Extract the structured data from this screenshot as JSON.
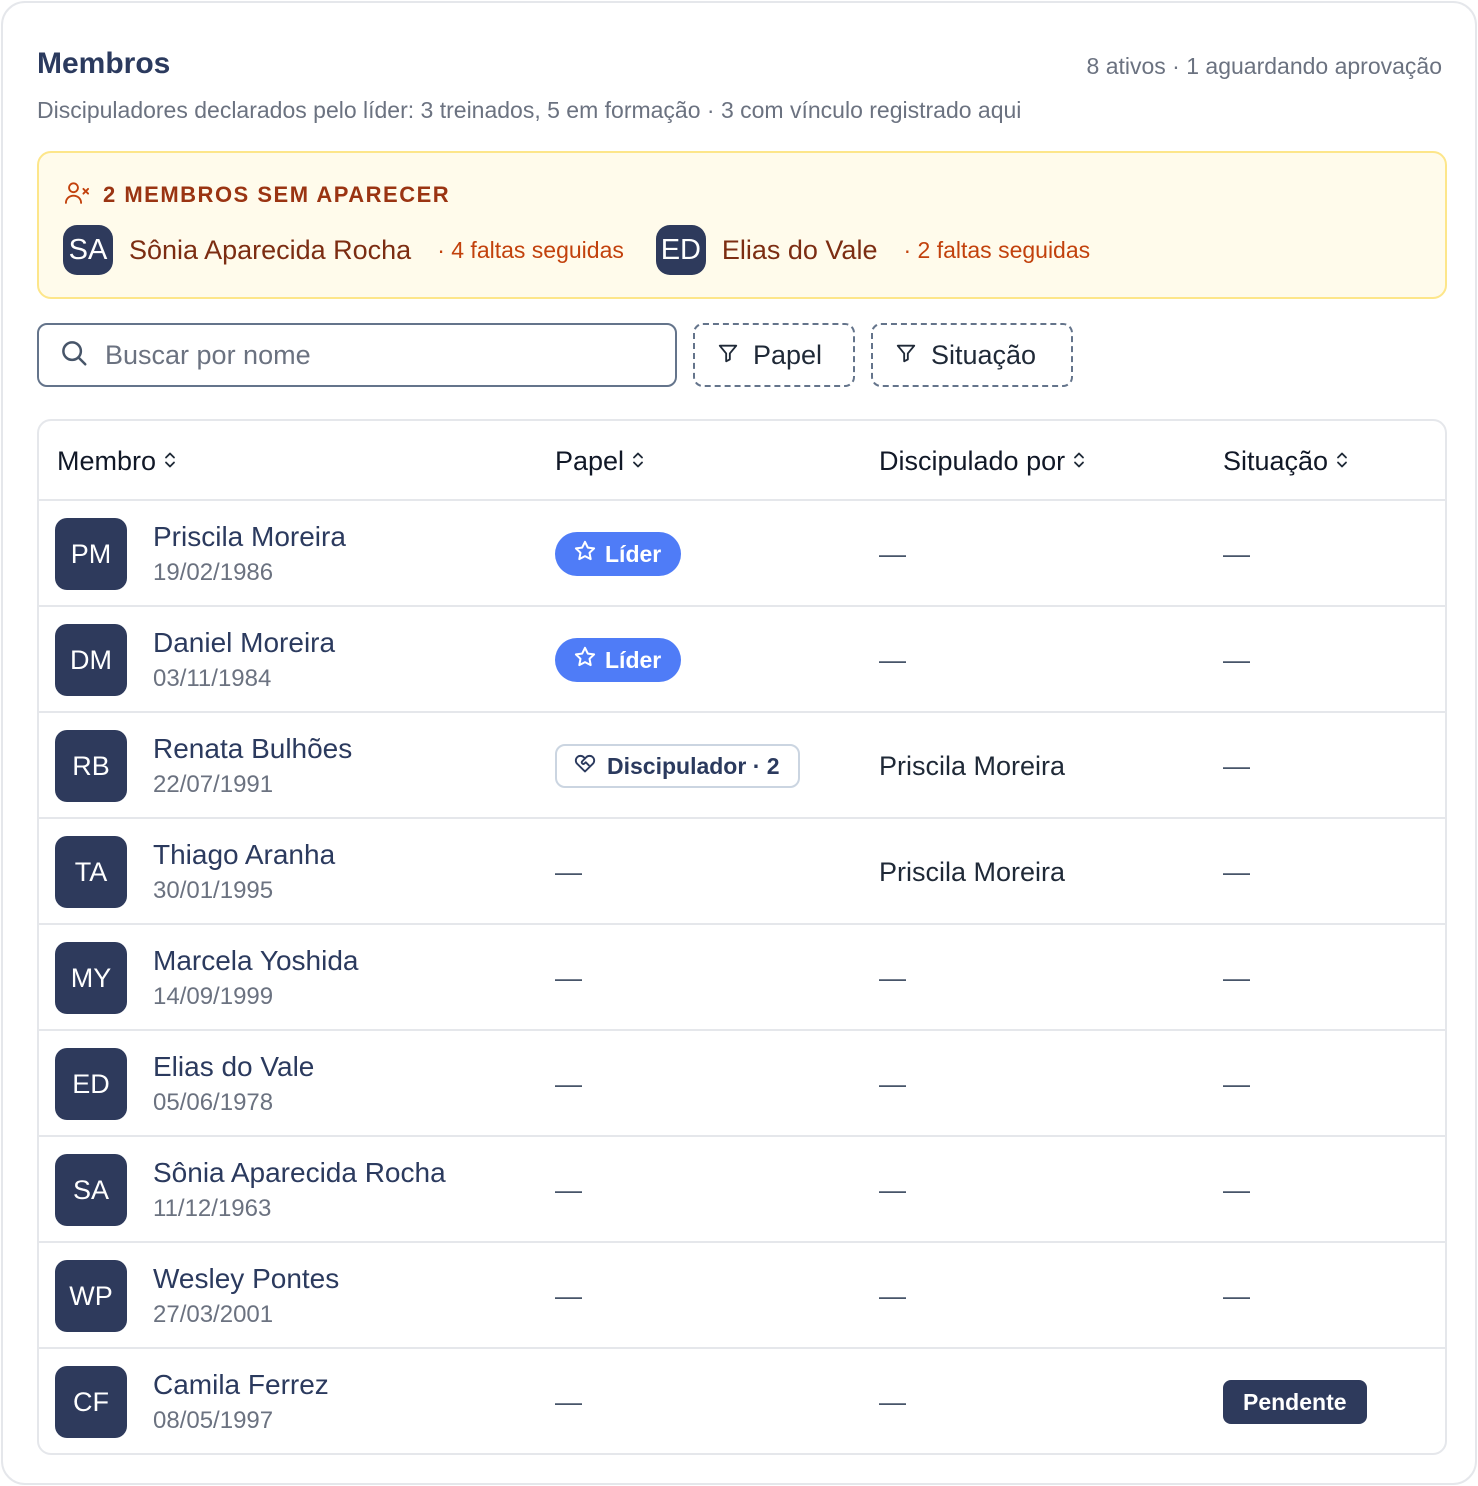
{
  "header": {
    "title": "Membros",
    "summary": "8 ativos · 1 aguardando aprovação",
    "subtitle": "Discipuladores declarados pelo líder: 3 treinados, 5 em formação · 3 com vínculo registrado aqui"
  },
  "alert": {
    "icon": "user-x-icon",
    "title": "2 MEMBROS SEM APARECER",
    "people": [
      {
        "initials": "SA",
        "name": "Sônia Aparecida Rocha",
        "absences": "· 4 faltas seguidas"
      },
      {
        "initials": "ED",
        "name": "Elias do Vale",
        "absences": "· 2 faltas seguidas"
      }
    ]
  },
  "toolbar": {
    "search_placeholder": "Buscar por nome",
    "filter_role_label": "Papel",
    "filter_status_label": "Situação"
  },
  "table": {
    "columns": [
      "Membro",
      "Papel",
      "Discipulado por",
      "Situação"
    ],
    "rows": [
      {
        "initials": "PM",
        "name": "Priscila Moreira",
        "date": "19/02/1986",
        "role": "Líder",
        "disciple_of": "—",
        "status": "—"
      },
      {
        "initials": "DM",
        "name": "Daniel Moreira",
        "date": "03/11/1984",
        "role": "Líder",
        "disciple_of": "—",
        "status": "—"
      },
      {
        "initials": "RB",
        "name": "Renata Bulhões",
        "date": "22/07/1991",
        "role": "Discipulador · 2",
        "disciple_of": "Priscila Moreira",
        "status": "—"
      },
      {
        "initials": "TA",
        "name": "Thiago Aranha",
        "date": "30/01/1995",
        "role": "—",
        "disciple_of": "Priscila Moreira",
        "status": "—"
      },
      {
        "initials": "MY",
        "name": "Marcela Yoshida",
        "date": "14/09/1999",
        "role": "—",
        "disciple_of": "—",
        "status": "—"
      },
      {
        "initials": "ED",
        "name": "Elias do Vale",
        "date": "05/06/1978",
        "role": "—",
        "disciple_of": "—",
        "status": "—"
      },
      {
        "initials": "SA",
        "name": "Sônia Aparecida Rocha",
        "date": "11/12/1963",
        "role": "—",
        "disciple_of": "—",
        "status": "—"
      },
      {
        "initials": "WP",
        "name": "Wesley Pontes",
        "date": "27/03/2001",
        "role": "—",
        "disciple_of": "—",
        "status": "—"
      },
      {
        "initials": "CF",
        "name": "Camila Ferrez",
        "date": "08/05/1997",
        "role": "—",
        "disciple_of": "—",
        "status": "Pendente"
      }
    ]
  },
  "colors": {
    "accent": "#4f7cf7",
    "navy": "#2e3a5c",
    "warning_bg": "#fffbeb",
    "warning_text": "#9a3412"
  }
}
